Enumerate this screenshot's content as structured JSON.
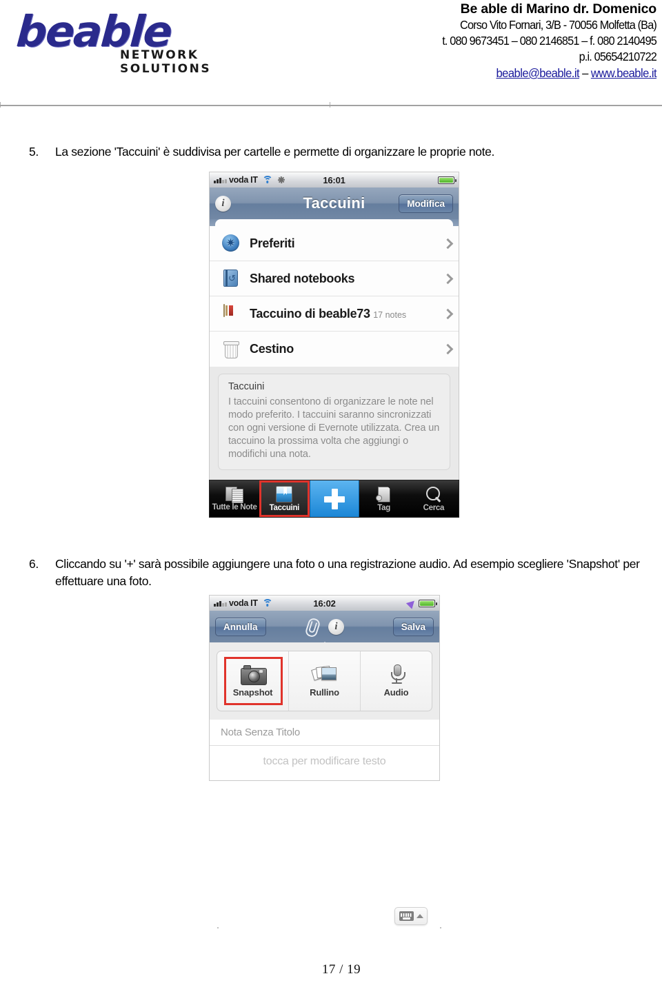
{
  "header": {
    "logo_word": "beable",
    "logo_sub": "NETWORK SOLUTIONS",
    "company_name": "Be able di Marino dr. Domenico",
    "address": "Corso Vito Fornari, 3/B - 70056 Molfetta (Ba)",
    "phones": "t. 080 9673451 – 080 2146851 – f.  080 2140495",
    "vat": "p.i. 05654210722",
    "email": "beable@beable.it",
    "link_separator": " – ",
    "website": "www.beable.it"
  },
  "steps": [
    {
      "number": "5.",
      "text": "La sezione 'Taccuini' è suddivisa per cartelle e permette di organizzare le proprie note."
    },
    {
      "number": "6.",
      "text": "Cliccando su '+' sarà possibile aggiungere una foto o una registrazione audio. Ad esempio scegliere 'Snapshot' per effettuare una foto."
    }
  ],
  "shot1": {
    "statusbar": {
      "carrier": "voda IT",
      "time": "16:01",
      "signal_icon": "signal-bars-icon",
      "wifi_icon": "wifi-icon",
      "sync_icon": "sync-spinner-icon",
      "battery_icon": "battery-icon"
    },
    "navbar": {
      "info_icon": "info-icon",
      "title": "Taccuini",
      "edit_button": "Modifica"
    },
    "list": [
      {
        "label": "Preferiti",
        "sub": "",
        "icon": "star-favorites-icon"
      },
      {
        "label": "Shared notebooks",
        "sub": "",
        "icon": "shared-notebook-icon"
      },
      {
        "label": "Taccuino di beable73",
        "sub": "17 notes",
        "icon": "notebook-icon"
      },
      {
        "label": "Cestino",
        "sub": "",
        "icon": "trash-icon"
      }
    ],
    "info_panel": {
      "title": "Taccuini",
      "body": "I taccuini consentono di organizzare le note nel modo preferito. I taccuini saranno sincronizzati con ogni versione di Evernote utilizzata. Crea un taccuino la prossima volta che aggiungi o modifichi una nota."
    },
    "tabbar": {
      "tabs": [
        {
          "label": "Tutte le Note",
          "icon": "all-notes-icon",
          "active": false,
          "highlighted": false
        },
        {
          "label": "Taccuini",
          "icon": "notebooks-icon",
          "active": true,
          "highlighted": true
        },
        {
          "label": "Tag",
          "icon": "tag-icon",
          "active": false,
          "highlighted": false
        },
        {
          "label": "Cerca",
          "icon": "search-icon",
          "active": false,
          "highlighted": false
        }
      ],
      "add_button_icon": "plus-icon"
    }
  },
  "shot2": {
    "statusbar": {
      "carrier": "voda IT",
      "time": "16:02",
      "signal_icon": "signal-bars-icon",
      "wifi_icon": "wifi-icon",
      "location_icon": "location-arrow-icon",
      "battery_icon": "battery-icon"
    },
    "navbar": {
      "cancel_button": "Annulla",
      "save_button": "Salva",
      "attach_icon": "paperclip-icon",
      "info_icon": "info-icon"
    },
    "attachments": [
      {
        "label": "Snapshot",
        "icon": "camera-icon",
        "highlighted": true
      },
      {
        "label": "Rullino",
        "icon": "photo-library-icon",
        "highlighted": false
      },
      {
        "label": "Audio",
        "icon": "microphone-icon",
        "highlighted": false
      }
    ],
    "note": {
      "title_placeholder": "Nota Senza Titolo",
      "body_placeholder": "tocca per modificare testo"
    }
  },
  "keyboard_button": {
    "icon": "keyboard-icon",
    "caret_icon": "chevron-up-icon"
  },
  "footer": {
    "page": "17 / 19"
  },
  "colors": {
    "logo_blue": "#2a2a8c",
    "link_blue": "#1a1a9c",
    "highlight_red": "#e0332b",
    "accent_blue": "#1b86d6",
    "navbar_blue": "#7288a5"
  }
}
